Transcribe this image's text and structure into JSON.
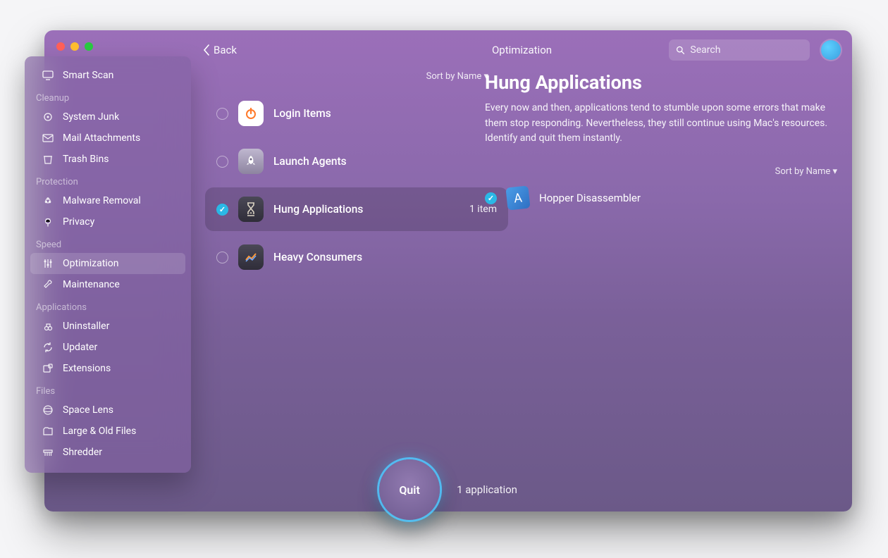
{
  "topbar": {
    "back": "Back",
    "title": "Optimization",
    "searchPlaceholder": "Search"
  },
  "sidebar": {
    "top": {
      "label": "Smart Scan"
    },
    "groups": [
      {
        "header": "Cleanup",
        "items": [
          {
            "id": "system-junk",
            "label": "System Junk"
          },
          {
            "id": "mail-attachments",
            "label": "Mail Attachments"
          },
          {
            "id": "trash-bins",
            "label": "Trash Bins"
          }
        ]
      },
      {
        "header": "Protection",
        "items": [
          {
            "id": "malware-removal",
            "label": "Malware Removal"
          },
          {
            "id": "privacy",
            "label": "Privacy"
          }
        ]
      },
      {
        "header": "Speed",
        "items": [
          {
            "id": "optimization",
            "label": "Optimization",
            "selected": true
          },
          {
            "id": "maintenance",
            "label": "Maintenance"
          }
        ]
      },
      {
        "header": "Applications",
        "items": [
          {
            "id": "uninstaller",
            "label": "Uninstaller"
          },
          {
            "id": "updater",
            "label": "Updater"
          },
          {
            "id": "extensions",
            "label": "Extensions"
          }
        ]
      },
      {
        "header": "Files",
        "items": [
          {
            "id": "space-lens",
            "label": "Space Lens"
          },
          {
            "id": "large-old-files",
            "label": "Large & Old Files"
          },
          {
            "id": "shredder",
            "label": "Shredder"
          }
        ]
      }
    ]
  },
  "mid": {
    "sort": "Sort by Name ▾",
    "categories": [
      {
        "id": "login-items",
        "label": "Login Items",
        "checked": false,
        "icon": "power",
        "iconBg": "#ffffff",
        "iconFg": "#ff7a2a"
      },
      {
        "id": "launch-agents",
        "label": "Launch Agents",
        "checked": false,
        "icon": "rocket",
        "iconBg": "linear-gradient(180deg,#bfb7cf,#8d84a0)",
        "iconFg": "#fff"
      },
      {
        "id": "hung-applications",
        "label": "Hung Applications",
        "checked": true,
        "selected": true,
        "count": "1 item",
        "icon": "hourglass",
        "iconBg": "linear-gradient(180deg,#4a4856,#2f2d39)",
        "iconFg": "#d9d2c2"
      },
      {
        "id": "heavy-consumers",
        "label": "Heavy Consumers",
        "checked": false,
        "icon": "chart",
        "iconBg": "linear-gradient(180deg,#4a4856,#2f2d39)",
        "iconFg": "#ff9a3a"
      }
    ]
  },
  "detail": {
    "title": "Hung Applications",
    "desc": "Every now and then, applications tend to stumble upon some errors that make them stop responding. Nevertheless, they still continue using Mac's resources. Identify and quit them instantly.",
    "sort": "Sort by Name ▾",
    "apps": [
      {
        "id": "hopper",
        "label": "Hopper Disassembler",
        "checked": true
      }
    ]
  },
  "action": {
    "button": "Quit",
    "summary": "1 application"
  },
  "icons": {
    "smart-scan": "⌖",
    "system-junk": "⚙",
    "mail-attachments": "✉",
    "trash-bins": "🗑",
    "malware-removal": "☣",
    "privacy": "✋",
    "optimization": "⚙",
    "maintenance": "🔧",
    "uninstaller": "⎋",
    "updater": "↻",
    "extensions": "⧉",
    "space-lens": "◎",
    "large-old-files": "🗂",
    "shredder": "✂"
  }
}
